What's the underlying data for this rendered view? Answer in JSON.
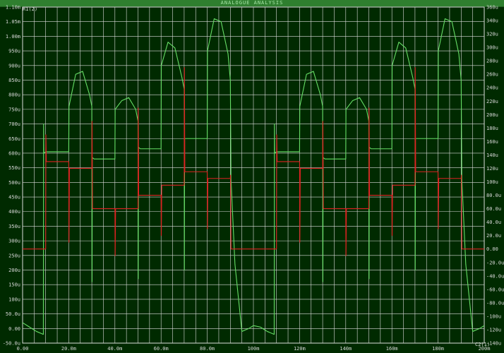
{
  "window": {
    "title": "ANALOGUE ANALYSIS"
  },
  "colors": {
    "background": "#002a00",
    "grid": "#dcdcdc",
    "trace_left": "#66dd66",
    "trace_right": "#dd2222",
    "text": "#d8d8d8"
  },
  "chart_data": {
    "type": "line",
    "xlim": [
      0,
      200
    ],
    "ylim_left": [
      -50,
      1100
    ],
    "ylim_right": [
      -140,
      360
    ],
    "x_ticks": [
      {
        "v": 0,
        "label": "0.00"
      },
      {
        "v": 20,
        "label": "20.0m"
      },
      {
        "v": 40,
        "label": "40.0m"
      },
      {
        "v": 60,
        "label": "60.0m"
      },
      {
        "v": 80,
        "label": "80.0m"
      },
      {
        "v": 100,
        "label": "100m"
      },
      {
        "v": 120,
        "label": "120m"
      },
      {
        "v": 140,
        "label": "140m"
      },
      {
        "v": 160,
        "label": "160m"
      },
      {
        "v": 180,
        "label": "180m"
      },
      {
        "v": 200,
        "label": "200m"
      }
    ],
    "y_left_ticks": [
      {
        "v": -50,
        "label": "-50.0u"
      },
      {
        "v": 0,
        "label": "0.00"
      },
      {
        "v": 50,
        "label": "50.0u"
      },
      {
        "v": 100,
        "label": "100u"
      },
      {
        "v": 150,
        "label": "150u"
      },
      {
        "v": 200,
        "label": "200u"
      },
      {
        "v": 250,
        "label": "250u"
      },
      {
        "v": 300,
        "label": "300u"
      },
      {
        "v": 350,
        "label": "350u"
      },
      {
        "v": 400,
        "label": "400u"
      },
      {
        "v": 450,
        "label": "450u"
      },
      {
        "v": 500,
        "label": "500u"
      },
      {
        "v": 550,
        "label": "550u"
      },
      {
        "v": 600,
        "label": "600u"
      },
      {
        "v": 650,
        "label": "650u"
      },
      {
        "v": 700,
        "label": "700u"
      },
      {
        "v": 750,
        "label": "750u"
      },
      {
        "v": 800,
        "label": "800u"
      },
      {
        "v": 850,
        "label": "850u"
      },
      {
        "v": 900,
        "label": "900u"
      },
      {
        "v": 950,
        "label": "950u"
      },
      {
        "v": 1000,
        "label": "1.00m"
      },
      {
        "v": 1050,
        "label": "1.05m"
      },
      {
        "v": 1100,
        "label": "1.10m"
      }
    ],
    "y_right_ticks": [
      {
        "v": -140,
        "label": "-140u"
      },
      {
        "v": -120,
        "label": "-120u"
      },
      {
        "v": -100,
        "label": "-100u"
      },
      {
        "v": -80,
        "label": "-80.0u"
      },
      {
        "v": -60,
        "label": "-60.0u"
      },
      {
        "v": -40,
        "label": "-40.0u"
      },
      {
        "v": -20,
        "label": "-20.0u"
      },
      {
        "v": 0,
        "label": "0.00"
      },
      {
        "v": 20,
        "label": "20.0u"
      },
      {
        "v": 40,
        "label": "40.0u"
      },
      {
        "v": 60,
        "label": "60.0u"
      },
      {
        "v": 80,
        "label": "80.0u"
      },
      {
        "v": 100,
        "label": "100u"
      },
      {
        "v": 120,
        "label": "120u"
      },
      {
        "v": 140,
        "label": "140u"
      },
      {
        "v": 160,
        "label": "160u"
      },
      {
        "v": 180,
        "label": "180u"
      },
      {
        "v": 200,
        "label": "200u"
      },
      {
        "v": 220,
        "label": "220u"
      },
      {
        "v": 240,
        "label": "240u"
      },
      {
        "v": 260,
        "label": "260u"
      },
      {
        "v": 280,
        "label": "280u"
      },
      {
        "v": 300,
        "label": "300u"
      },
      {
        "v": 320,
        "label": "320u"
      },
      {
        "v": 340,
        "label": "340u"
      },
      {
        "v": 360,
        "label": "360u"
      }
    ],
    "label_left": "R1(2)",
    "label_right": "C2(1)",
    "series": [
      {
        "axis": "left",
        "color": "#66dd66",
        "x": [
          0,
          3,
          6,
          9,
          9.1,
          9.2,
          10,
          19.9,
          20,
          20.1,
          23,
          26,
          29,
          30,
          30.1,
          30.2,
          31,
          39.9,
          40,
          40.1,
          43,
          46,
          49,
          50,
          50.1,
          50.2,
          51,
          59.9,
          60,
          60.1,
          63,
          66,
          69,
          70,
          70.1,
          70.2,
          71,
          79.9,
          80,
          80.1,
          83,
          86,
          89,
          90,
          90.3,
          92,
          95,
          98,
          100,
          103,
          106,
          109,
          109.1,
          109.2,
          110,
          119.9,
          120,
          120.1,
          123,
          126,
          129,
          130,
          130.1,
          130.2,
          131,
          139.9,
          140,
          140.1,
          143,
          146,
          149,
          150,
          150.1,
          150.2,
          151,
          159.9,
          160,
          160.1,
          163,
          166,
          169,
          170,
          170.1,
          170.2,
          171,
          179.9,
          180,
          180.1,
          183,
          186,
          189,
          190,
          190.3,
          192,
          195,
          198,
          200
        ],
        "y": [
          20,
          5,
          -10,
          -20,
          700,
          600,
          605,
          605,
          605,
          760,
          870,
          880,
          800,
          760,
          160,
          585,
          580,
          580,
          580,
          750,
          780,
          790,
          750,
          710,
          170,
          620,
          615,
          615,
          615,
          900,
          980,
          960,
          860,
          820,
          200,
          650,
          650,
          650,
          650,
          950,
          1060,
          1050,
          940,
          850,
          510,
          220,
          -10,
          0,
          10,
          5,
          -10,
          -20,
          700,
          600,
          605,
          605,
          605,
          760,
          870,
          880,
          800,
          760,
          160,
          585,
          580,
          580,
          580,
          750,
          780,
          790,
          750,
          710,
          170,
          620,
          615,
          615,
          615,
          900,
          980,
          960,
          860,
          820,
          200,
          650,
          650,
          650,
          650,
          950,
          1060,
          1050,
          940,
          850,
          510,
          220,
          -10,
          0,
          10
        ]
      },
      {
        "axis": "right",
        "color": "#dd2222",
        "x": [
          0,
          9.9,
          10,
          10.1,
          10.3,
          11,
          19.9,
          20,
          20.1,
          20.3,
          21,
          29.9,
          30,
          30.1,
          30.3,
          31,
          39.9,
          40,
          40.1,
          40.3,
          41,
          49.9,
          50,
          50.1,
          50.3,
          51,
          59.9,
          60,
          60.1,
          60.3,
          61,
          69.9,
          70,
          70.1,
          70.3,
          71,
          79.9,
          80,
          80.1,
          80.3,
          81,
          89.9,
          90,
          90.1,
          90.3,
          91,
          109.9,
          110,
          110.1,
          110.3,
          111,
          119.9,
          120,
          120.1,
          120.3,
          121,
          129.9,
          130,
          130.1,
          130.3,
          131,
          139.9,
          140,
          140.1,
          140.3,
          141,
          149.9,
          150,
          150.1,
          150.3,
          151,
          159.9,
          160,
          160.1,
          160.3,
          161,
          169.9,
          170,
          170.1,
          170.3,
          171,
          179.9,
          180,
          180.1,
          180.3,
          181,
          189.9,
          190,
          190.1,
          190.3,
          191,
          200
        ],
        "y": [
          0,
          0,
          0,
          170,
          130,
          130,
          130,
          130,
          10,
          120,
          120,
          120,
          120,
          190,
          60,
          60,
          60,
          60,
          -10,
          60,
          60,
          60,
          60,
          210,
          80,
          80,
          80,
          80,
          20,
          95,
          95,
          95,
          95,
          270,
          115,
          115,
          115,
          115,
          30,
          105,
          105,
          105,
          105,
          110,
          0,
          0,
          0,
          0,
          170,
          130,
          130,
          130,
          130,
          10,
          120,
          120,
          120,
          120,
          190,
          60,
          60,
          60,
          60,
          -10,
          60,
          60,
          60,
          60,
          210,
          80,
          80,
          80,
          80,
          20,
          95,
          95,
          95,
          95,
          270,
          115,
          115,
          115,
          115,
          30,
          105,
          105,
          105,
          105,
          110,
          0,
          0,
          0
        ]
      }
    ]
  }
}
